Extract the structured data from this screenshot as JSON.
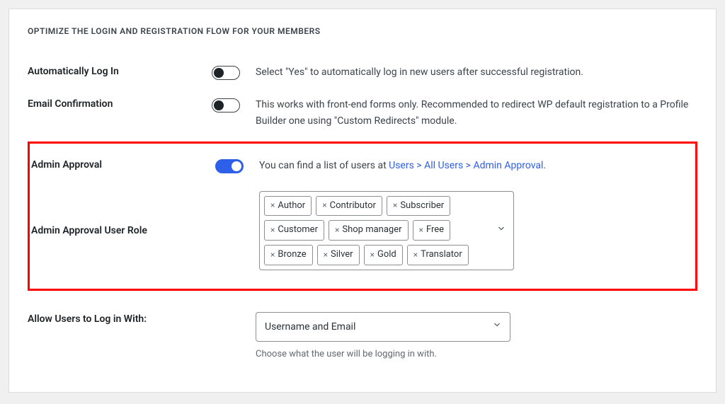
{
  "section_title": "OPTIMIZE THE LOGIN AND REGISTRATION FLOW FOR YOUR MEMBERS",
  "auto_login": {
    "label": "Automatically Log In",
    "desc": "Select \"Yes\" to automatically log in new users after successful registration.",
    "state": "off"
  },
  "email_confirm": {
    "label": "Email Confirmation",
    "desc": "This works with front-end forms only. Recommended to redirect WP default registration to a Profile Builder one using \"Custom Redirects\" module.",
    "state": "off"
  },
  "admin_approval": {
    "label": "Admin Approval",
    "desc_prefix": "You can find a list of users at ",
    "link_text": "Users > All Users > Admin Approval",
    "desc_suffix": ".",
    "state": "on"
  },
  "admin_approval_roles": {
    "label": "Admin Approval User Role",
    "roles": [
      "Author",
      "Contributor",
      "Subscriber",
      "Customer",
      "Shop manager",
      "Free",
      "Bronze",
      "Silver",
      "Gold",
      "Translator"
    ]
  },
  "login_with": {
    "label": "Allow Users to Log in With:",
    "value": "Username and Email",
    "help": "Choose what the user will be logging in with."
  }
}
